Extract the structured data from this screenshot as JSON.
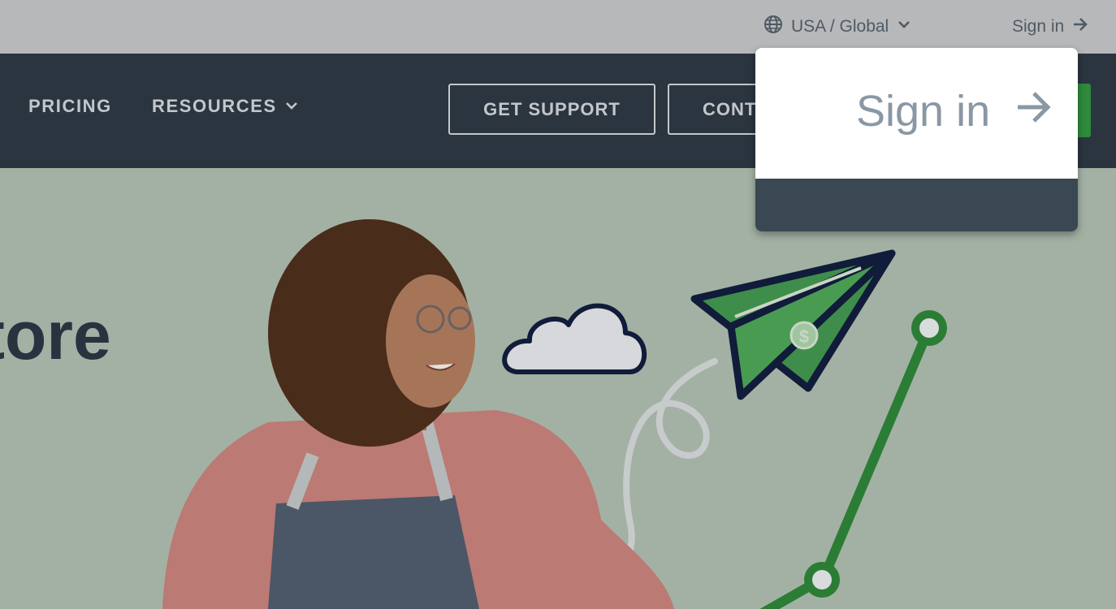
{
  "topbar": {
    "region_label": "USA / Global",
    "signin_label": "Sign in"
  },
  "nav": {
    "links": [
      {
        "label": "PRICING"
      },
      {
        "label": "RESOURCES"
      }
    ],
    "buttons": {
      "support": "GET SUPPORT",
      "contact": "CONT"
    }
  },
  "hero": {
    "title_fragment": "tore"
  },
  "popup": {
    "signin_label": "Sign in"
  },
  "colors": {
    "nav_bg": "#2b3540",
    "accent_green": "#2f8a3b",
    "hero_bg": "#a3b1a4"
  },
  "icons": [
    "globe-icon",
    "chevron-down-icon",
    "arrow-right-icon",
    "cloud-illustration",
    "paper-plane-illustration",
    "growth-line-illustration",
    "person-photo"
  ]
}
